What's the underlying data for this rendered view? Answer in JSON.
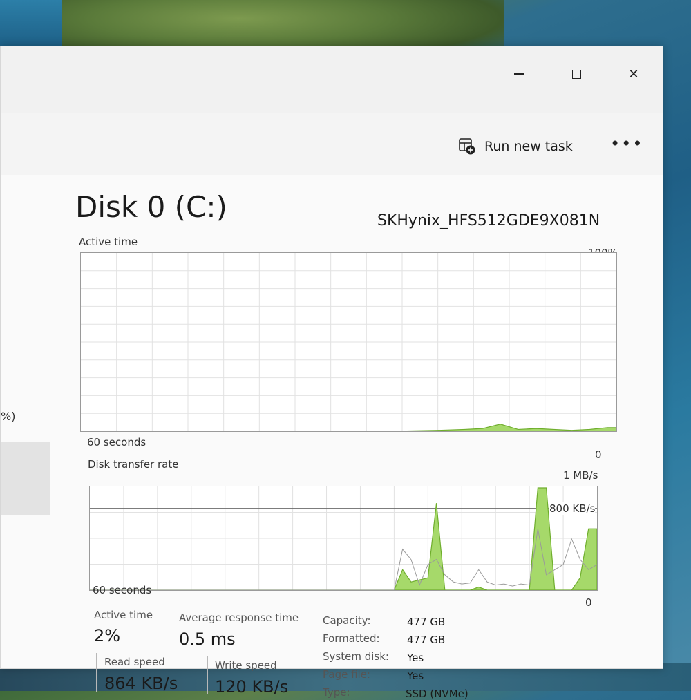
{
  "window": {
    "minimize_glyph": "—",
    "close_glyph": "✕"
  },
  "commandbar": {
    "run_new_task_label": "Run new task",
    "more_glyph": "•••"
  },
  "sidebar": {
    "fragment_text": "%)"
  },
  "disk": {
    "title": "Disk 0 (C:)",
    "model": "SKHynix_HFS512GDE9X081N"
  },
  "active_time_chart": {
    "label": "Active time",
    "max_label": "100%",
    "time_label": "60 seconds",
    "min_label": "0"
  },
  "transfer_chart": {
    "label": "Disk transfer rate",
    "max_label": "1 MB/s",
    "mid_label": "800 KB/s",
    "time_label": "60 seconds",
    "min_label": "0"
  },
  "stats": {
    "active_time_label": "Active time",
    "active_time_value": "2%",
    "avg_response_label": "Average response time",
    "avg_response_value": "0.5 ms",
    "read_speed_label": "Read speed",
    "read_speed_value": "864 KB/s",
    "write_speed_label": "Write speed",
    "write_speed_value": "120 KB/s"
  },
  "properties": [
    {
      "label": "Capacity:",
      "value": "477 GB"
    },
    {
      "label": "Formatted:",
      "value": "477 GB"
    },
    {
      "label": "System disk:",
      "value": "Yes"
    },
    {
      "label": "Page file:",
      "value": "Yes"
    },
    {
      "label": "Type:",
      "value": "SSD (NVMe)"
    }
  ],
  "colors": {
    "graph_fill": "#a6d96a",
    "graph_stroke": "#6fae2d",
    "grid": "#e2e2e2",
    "write_line": "#9a9a9a"
  },
  "chart_data": [
    {
      "type": "area",
      "title": "Active time",
      "xlabel": "60 seconds",
      "ylabel": "",
      "ylim": [
        0,
        100
      ],
      "x": [
        60,
        55,
        50,
        45,
        40,
        35,
        30,
        25,
        20,
        17,
        15,
        13,
        11,
        9,
        7,
        5,
        3,
        1,
        0
      ],
      "series": [
        {
          "values": [
            0,
            0,
            0,
            0,
            0,
            0,
            0,
            0,
            0.5,
            1,
            1.5,
            4,
            1,
            1.5,
            1,
            0.5,
            1,
            2,
            2
          ]
        }
      ]
    },
    {
      "type": "area",
      "title": "Disk transfer rate",
      "xlabel": "60 seconds",
      "ylabel": "",
      "ylim": [
        0,
        1000
      ],
      "x": [
        60,
        50,
        40,
        30,
        24,
        23,
        22,
        21,
        20,
        19,
        18,
        17,
        16,
        15,
        14,
        13,
        12,
        11,
        10,
        9,
        8,
        7,
        6,
        5,
        4,
        3,
        2,
        1,
        0
      ],
      "series": [
        {
          "values": [
            0,
            0,
            0,
            0,
            0,
            200,
            80,
            100,
            120,
            850,
            0,
            0,
            0,
            0,
            30,
            0,
            0,
            0,
            0,
            0,
            0,
            1000,
            1000,
            0,
            0,
            0,
            120,
            600,
            600
          ]
        },
        {
          "values": [
            0,
            0,
            0,
            0,
            0,
            400,
            300,
            50,
            250,
            300,
            150,
            80,
            60,
            70,
            200,
            80,
            50,
            60,
            40,
            60,
            50,
            600,
            150,
            200,
            250,
            500,
            300,
            200,
            250
          ]
        }
      ]
    }
  ]
}
